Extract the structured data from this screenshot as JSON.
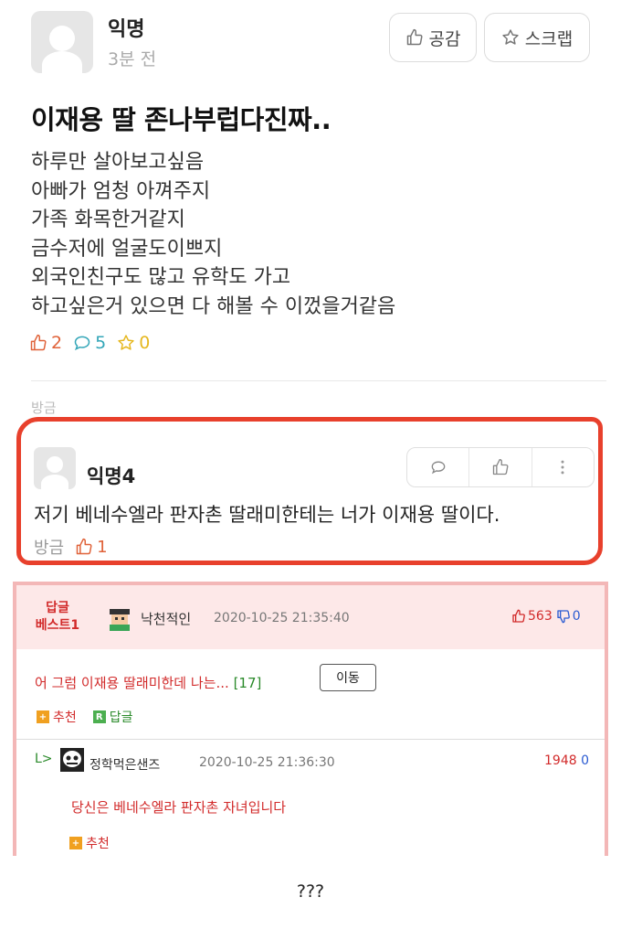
{
  "post": {
    "author": "익명",
    "time": "3분 전",
    "like_button": "공감",
    "scrap_button": "스크랩",
    "title": "이재용 딸 존나부럽다진짜..",
    "content": [
      "하루만 살아보고싶음",
      "아빠가 엄청 아껴주지",
      "가족 화목한거같지",
      "금수저에 얼굴도이쁘지",
      "외국인친구도 많고 유학도 가고",
      "하고싶은거 있으면 다 해볼 수 이껐을거같음"
    ],
    "stats": {
      "likes": "2",
      "comments": "5",
      "scraps": "0"
    },
    "cut_label": "방금"
  },
  "comment": {
    "author": "익명4",
    "text": "저기 베네수엘라 판자촌 딸래미한테는 너가 이재용 딸이다.",
    "time": "방금",
    "likes": "1"
  },
  "best_reply": {
    "badge_line1": "답글",
    "badge_line2": "베스트1",
    "user": "낙천적인",
    "date": "2020-10-25 21:35:40",
    "up": "563",
    "down": "0",
    "text": "어 그럼 이재용 딸래미한데 나는...",
    "count": "[17]",
    "move_button": "이동",
    "recommend_label": "추천",
    "reply_label": "답글",
    "nested": {
      "arrow": "L>",
      "user": "정학먹은샌즈",
      "date": "2020-10-25 21:36:30",
      "up": "1948",
      "down": "0",
      "text": "당신은 베네수엘라 판자촌 자녀입니다",
      "recommend_label": "추천"
    }
  },
  "caption": "???",
  "colors": {
    "accent_red": "#e8402c",
    "best_pink": "#fde8e8",
    "best_red": "#d22b2b",
    "best_green": "#2a8a2a"
  }
}
